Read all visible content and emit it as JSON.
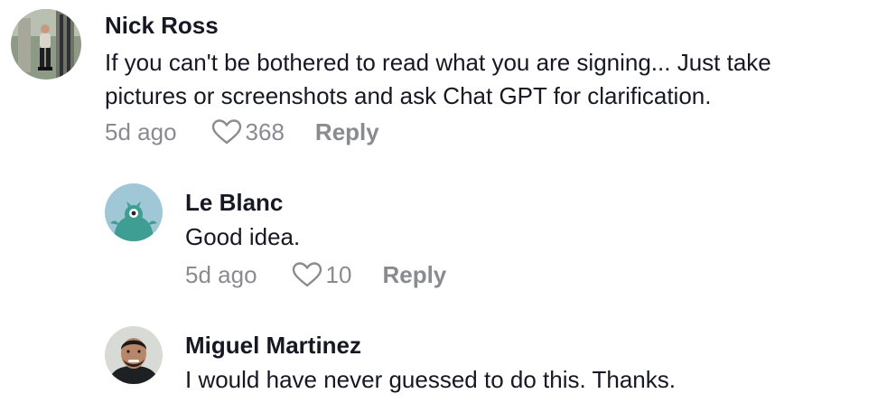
{
  "comments": [
    {
      "author": "Nick Ross",
      "lines": [
        "If you can't be bothered to read what you are signing... Just take",
        "pictures or screenshots and ask Chat GPT for clarification."
      ],
      "time": "5d ago",
      "likes": "368",
      "reply_label": "Reply",
      "avatar_icon": "user-photo-avatar"
    },
    {
      "author": "Le Blanc",
      "lines": [
        "Good idea."
      ],
      "time": "5d ago",
      "likes": "10",
      "reply_label": "Reply",
      "avatar_icon": "teal-monster-avatar"
    },
    {
      "author": "Miguel Martinez",
      "lines": [
        "I would have never guessed to do this. Thanks."
      ],
      "avatar_icon": "user-photo-avatar"
    }
  ],
  "colors": {
    "text_primary": "#161823",
    "text_secondary": "#8a8b91",
    "avatar_teal_bg": "#9fc7d6",
    "avatar_teal_monster": "#3f9e93"
  }
}
